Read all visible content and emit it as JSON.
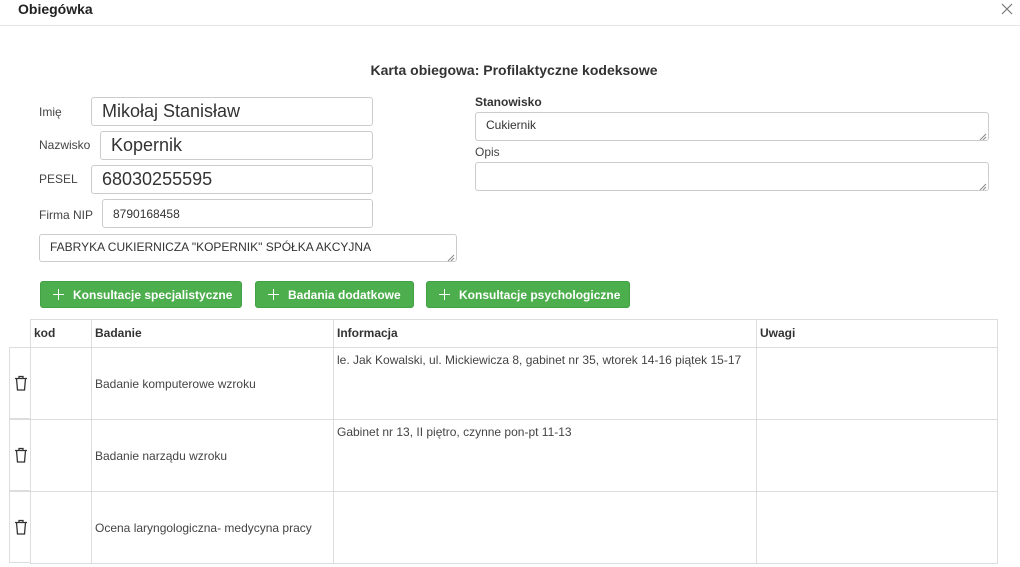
{
  "dialog": {
    "title": "Obiegówka",
    "close_icon": "close-icon"
  },
  "form": {
    "title": "Karta obiegowa: Profilaktyczne kodeksowe",
    "first_name": {
      "label": "Imię",
      "value": "Mikołaj Stanisław"
    },
    "last_name": {
      "label": "Nazwisko",
      "value": "Kopernik"
    },
    "pesel": {
      "label": "PESEL",
      "value": "68030255595"
    },
    "nip": {
      "label": "Firma NIP",
      "value": "8790168458"
    },
    "company": {
      "value": "FABRYKA CUKIERNICZA \"KOPERNIK\" SPÓŁKA AKCYJNA"
    },
    "position": {
      "label": "Stanowisko",
      "value": "Cukiernik"
    },
    "description": {
      "label": "Opis",
      "value": ""
    }
  },
  "buttons": {
    "specialist": "Konsultacje specjalistyczne",
    "additional": "Badania dodatkowe",
    "psychological": "Konsultacje psychologiczne"
  },
  "table": {
    "columns": [
      "kod",
      "Badanie",
      "Informacja",
      "Uwagi"
    ],
    "rows": [
      {
        "kod": "",
        "badanie": "Badanie komputerowe wzroku",
        "informacja": "le. Jak Kowalski, ul. Mickiewicza 8, gabinet nr 35, wtorek 14-16 piątek 15-17",
        "uwagi": ""
      },
      {
        "kod": "",
        "badanie": "Badanie narządu wzroku",
        "informacja": "Gabinet nr 13, II piętro, czynne pon-pt 11-13",
        "uwagi": ""
      },
      {
        "kod": "",
        "badanie": "Ocena laryngologiczna- medycyna pracy",
        "informacja": "",
        "uwagi": ""
      }
    ]
  },
  "colors": {
    "button_green": "#4cae4c",
    "border": "#cccccc"
  }
}
